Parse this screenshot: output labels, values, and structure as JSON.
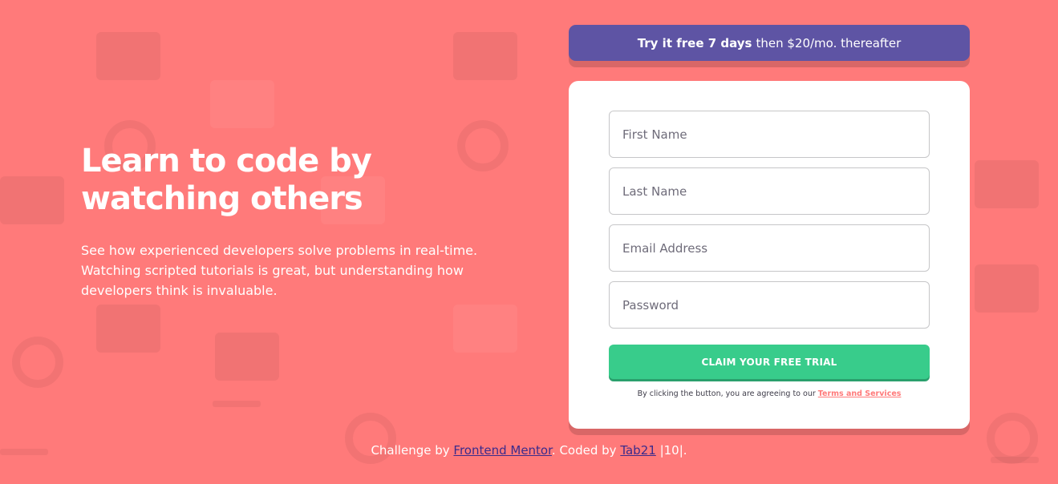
{
  "intro": {
    "heading_line1": "Learn to code by",
    "heading_line2": "watching others",
    "description": "See how experienced developers solve problems in real-time. Watching scripted tutorials is great, but understanding how developers think is invaluable."
  },
  "promo": {
    "strong": "Try it free 7 days",
    "rest": "then $20/mo. thereafter"
  },
  "form": {
    "first_name_placeholder": "First Name",
    "last_name_placeholder": "Last Name",
    "email_placeholder": "Email Address",
    "password_placeholder": "Password",
    "submit_label": "CLAIM YOUR FREE TRIAL",
    "terms_prefix": "By clicking the button, you are agreeing to our",
    "terms_link": "Terms and Services"
  },
  "footer": {
    "prefix": "Challenge by",
    "mentor_link": "Frontend Mentor",
    "middle": ". Coded by",
    "coder_link": "Tab21",
    "suffix": "|10|."
  },
  "colors": {
    "background": "#ff7a7a",
    "promo": "#5e54a4",
    "button": "#38cc8b",
    "terms_link": "#ff7a7a"
  }
}
